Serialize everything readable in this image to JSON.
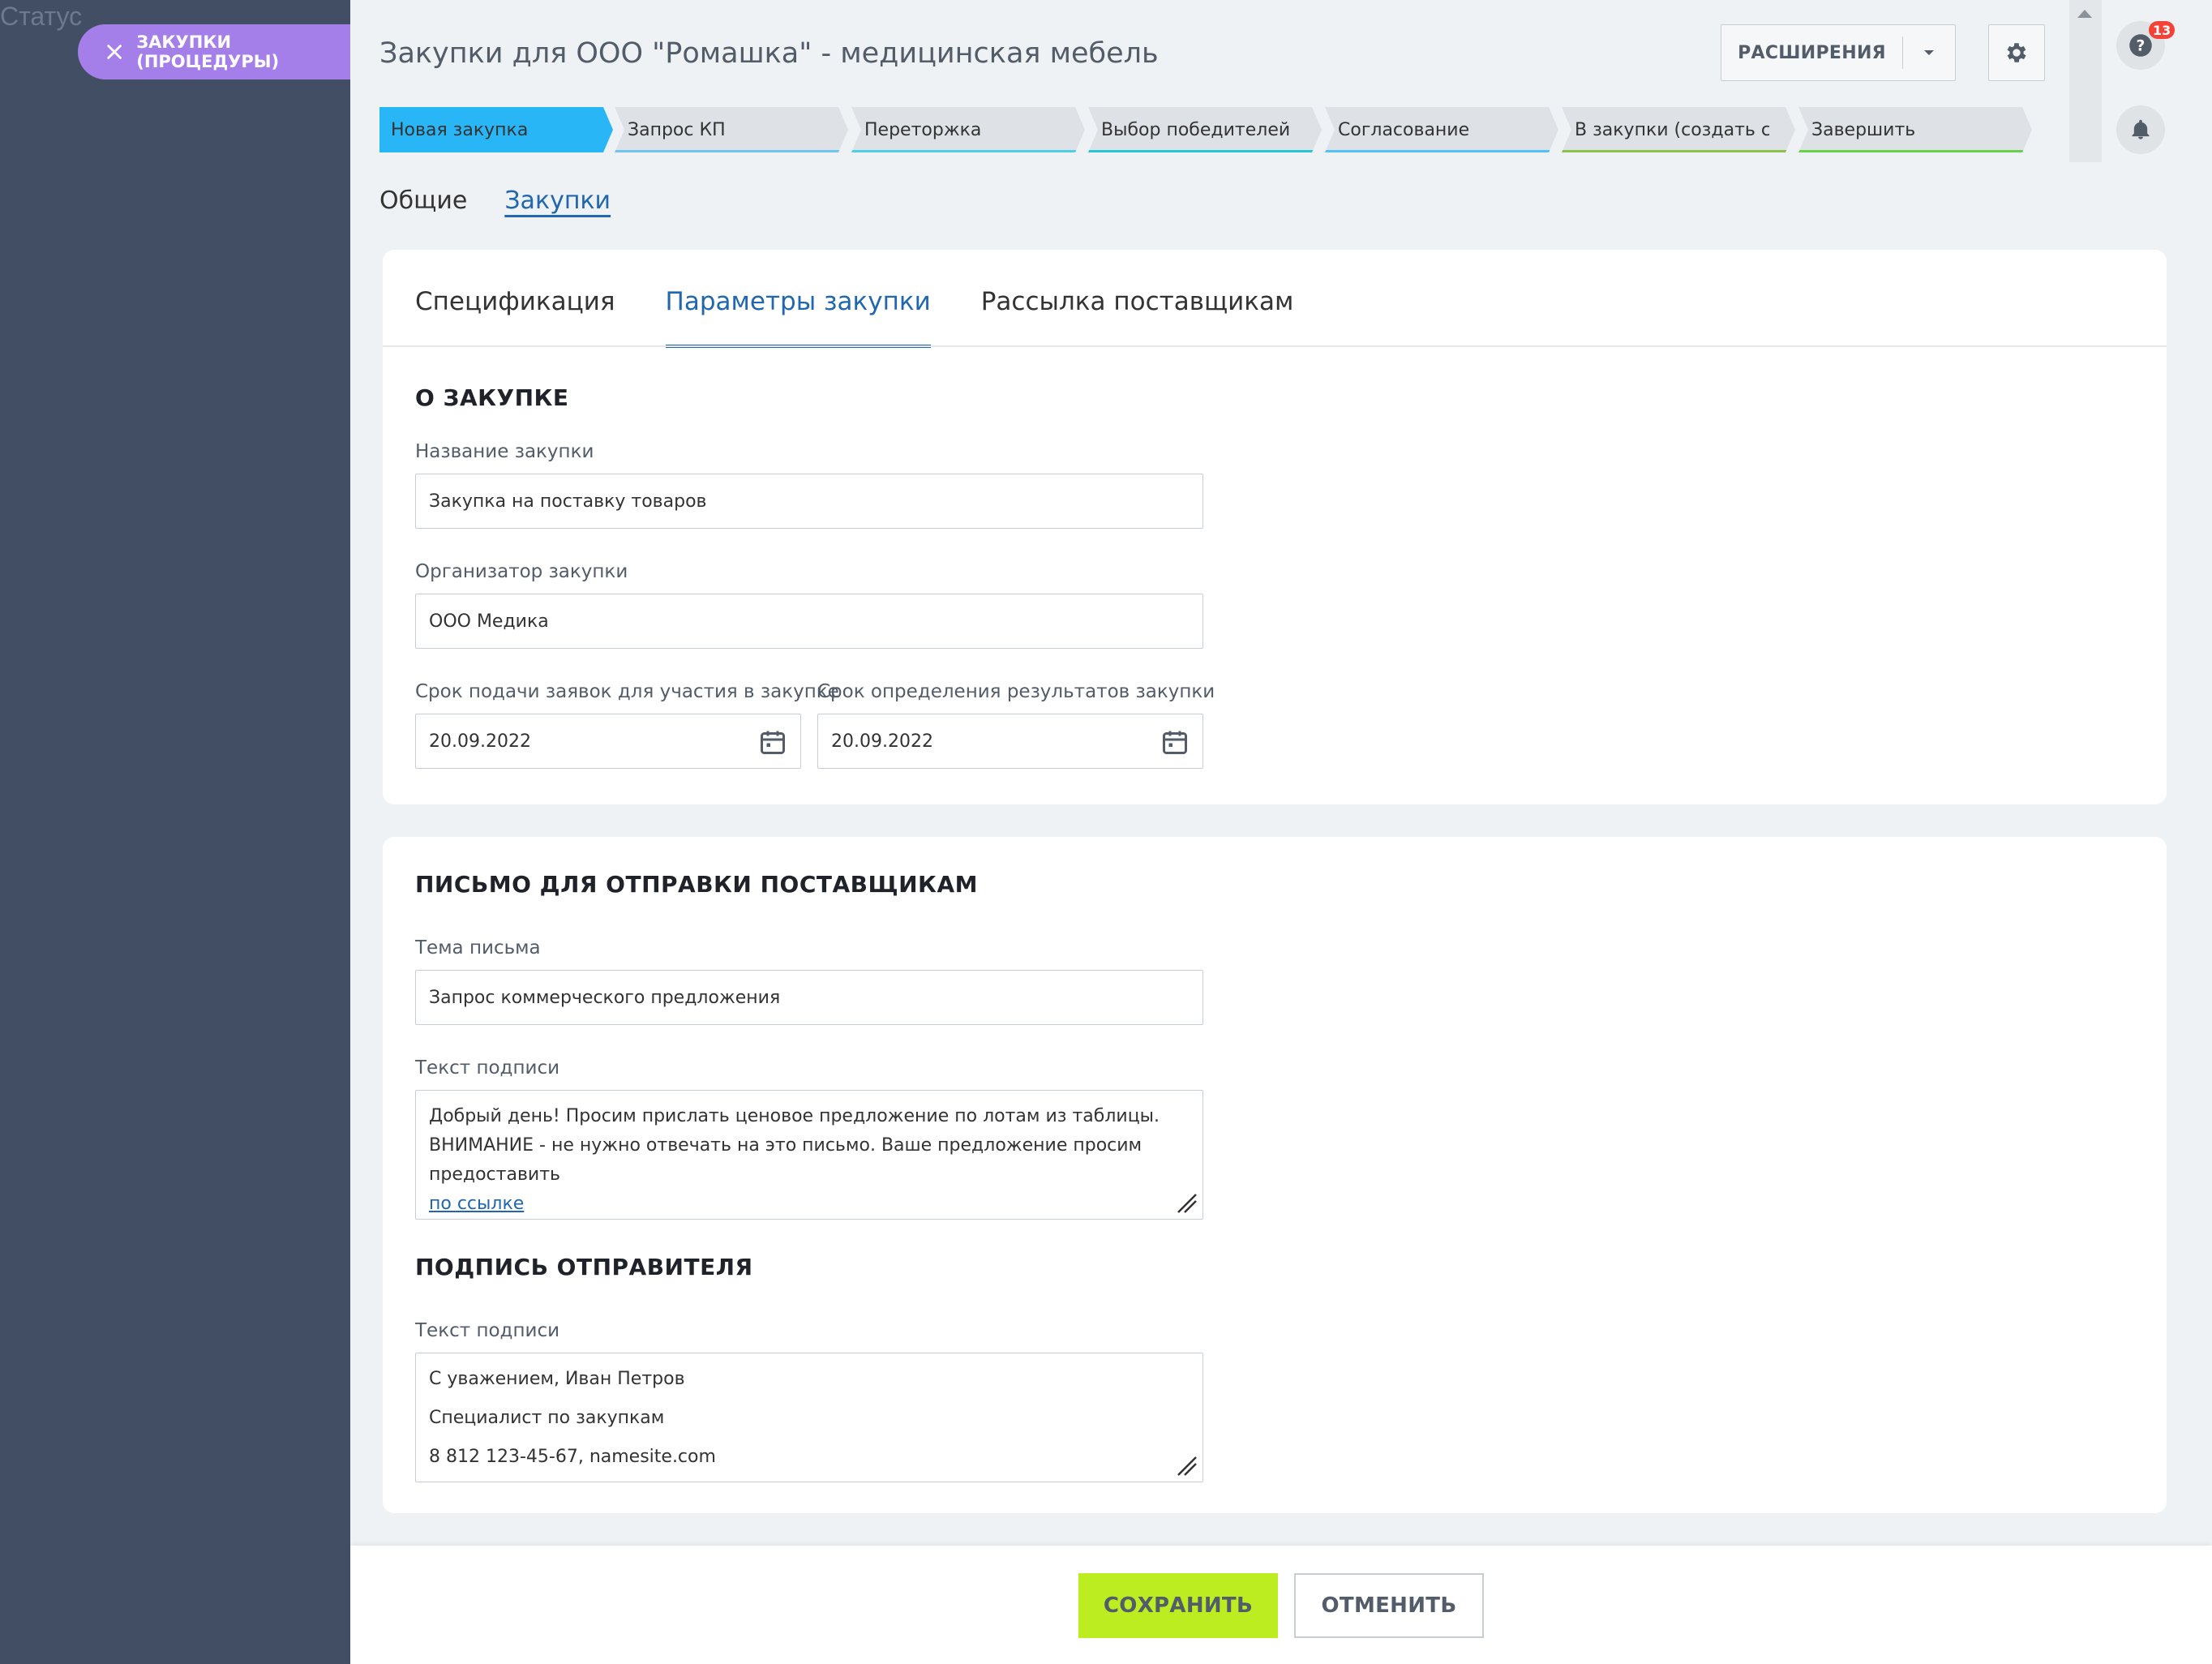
{
  "left_panel": {
    "status_text": "Статус",
    "close_label": "ЗАКУПКИ (ПРОЦЕДУРЫ)"
  },
  "header": {
    "title": "Закупки для ООО \"Ромашка\" - медицинская мебель",
    "extensions_label": "РАСШИРЕНИЯ",
    "notifications_count": "13"
  },
  "stages": [
    {
      "label": "Новая закупка",
      "active": true,
      "color": "#29b6f6"
    },
    {
      "label": "Запрос КП",
      "color": "#6fc5ef"
    },
    {
      "label": "Переторжка",
      "color": "#4dd0e1"
    },
    {
      "label": "Выбор победителей",
      "color": "#26c6da"
    },
    {
      "label": "Согласование",
      "color": "#4fc3f7"
    },
    {
      "label": "В закупки (создать сде...",
      "color": "#8bc34a"
    },
    {
      "label": "Завершить",
      "color": "#66d24a"
    }
  ],
  "top_tabs": [
    {
      "label": "Общие"
    },
    {
      "label": "Закупки",
      "active": true
    }
  ],
  "sub_tabs": [
    {
      "label": "Спецификация"
    },
    {
      "label": "Параметры закупки",
      "active": true
    },
    {
      "label": "Рассылка поставщикам"
    }
  ],
  "about": {
    "title": "О ЗАКУПКЕ",
    "name_label": "Название закупки",
    "name_value": "Закупка на поставку товаров",
    "organizer_label": "Организатор закупки",
    "organizer_value": "ООО Медика",
    "deadline_label": "Срок подачи заявок для участия в закупке",
    "deadline_value": "20.09.2022",
    "results_label": "Срок определения результатов закупки",
    "results_value": "20.09.2022"
  },
  "letter": {
    "title": "ПИСЬМО ДЛЯ ОТПРАВКИ ПОСТАВЩИКАМ",
    "subject_label": "Тема письма",
    "subject_value": "Запрос коммерческого предложения",
    "body_label": "Текст подписи",
    "body_line1": "Добрый день! Просим прислать ценовое предложение по лотам из таблицы.",
    "body_line2": "ВНИМАНИЕ - не нужно отвечать на это письмо. Ваше предложение просим предоставить",
    "body_link": "по ссылке"
  },
  "signature": {
    "title": "ПОДПИСЬ ОТПРАВИТЕЛЯ",
    "label": "Текст подписи",
    "line1": "С уважением, Иван Петров",
    "line2": "Специалист по закупкам",
    "line3": "8 812 123-45-67, namesite.com"
  },
  "actions": {
    "save": "СОХРАНИТЬ",
    "cancel": "ОТМЕНИТЬ"
  },
  "colors": {
    "left_panel": "#414e63",
    "close_pill": "#a47ee9",
    "save_button": "#bbed21",
    "accent_link": "#2067b0",
    "badge": "#f44336"
  }
}
